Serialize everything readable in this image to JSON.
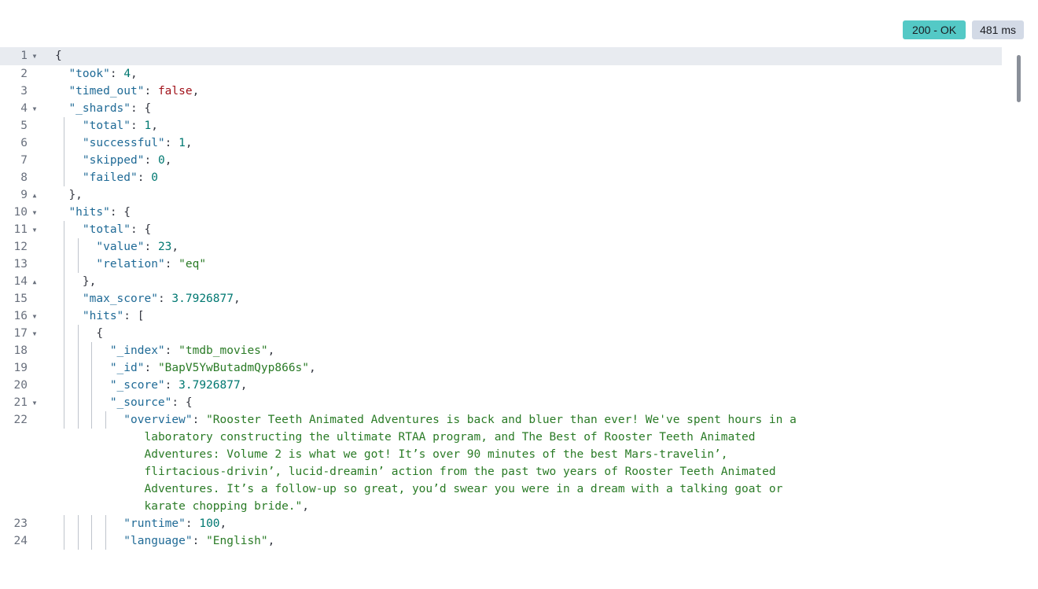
{
  "status": {
    "code_label": "200 - OK",
    "time_label": "481 ms"
  },
  "lines": [
    {
      "n": "1",
      "fold": "open",
      "indent": 0,
      "segs": [
        [
          "p",
          "{"
        ]
      ]
    },
    {
      "n": "2",
      "indent": 1,
      "segs": [
        [
          "k",
          "\"took\""
        ],
        [
          "p",
          ": "
        ],
        [
          "num-v",
          "4"
        ],
        [
          "p",
          ","
        ]
      ]
    },
    {
      "n": "3",
      "indent": 1,
      "segs": [
        [
          "k",
          "\"timed_out\""
        ],
        [
          "p",
          ": "
        ],
        [
          "bool",
          "false"
        ],
        [
          "p",
          ","
        ]
      ]
    },
    {
      "n": "4",
      "fold": "open",
      "indent": 1,
      "segs": [
        [
          "k",
          "\"_shards\""
        ],
        [
          "p",
          ": {"
        ]
      ]
    },
    {
      "n": "5",
      "indent": 2,
      "segs": [
        [
          "k",
          "\"total\""
        ],
        [
          "p",
          ": "
        ],
        [
          "num-v",
          "1"
        ],
        [
          "p",
          ","
        ]
      ]
    },
    {
      "n": "6",
      "indent": 2,
      "segs": [
        [
          "k",
          "\"successful\""
        ],
        [
          "p",
          ": "
        ],
        [
          "num-v",
          "1"
        ],
        [
          "p",
          ","
        ]
      ]
    },
    {
      "n": "7",
      "indent": 2,
      "segs": [
        [
          "k",
          "\"skipped\""
        ],
        [
          "p",
          ": "
        ],
        [
          "num-v",
          "0"
        ],
        [
          "p",
          ","
        ]
      ]
    },
    {
      "n": "8",
      "indent": 2,
      "segs": [
        [
          "k",
          "\"failed\""
        ],
        [
          "p",
          ": "
        ],
        [
          "num-v",
          "0"
        ]
      ]
    },
    {
      "n": "9",
      "fold": "close",
      "indent": 1,
      "segs": [
        [
          "p",
          "},"
        ]
      ]
    },
    {
      "n": "10",
      "fold": "open",
      "indent": 1,
      "segs": [
        [
          "k",
          "\"hits\""
        ],
        [
          "p",
          ": {"
        ]
      ]
    },
    {
      "n": "11",
      "fold": "open",
      "indent": 2,
      "segs": [
        [
          "k",
          "\"total\""
        ],
        [
          "p",
          ": {"
        ]
      ]
    },
    {
      "n": "12",
      "indent": 3,
      "segs": [
        [
          "k",
          "\"value\""
        ],
        [
          "p",
          ": "
        ],
        [
          "num-v",
          "23"
        ],
        [
          "p",
          ","
        ]
      ]
    },
    {
      "n": "13",
      "indent": 3,
      "segs": [
        [
          "k",
          "\"relation\""
        ],
        [
          "p",
          ": "
        ],
        [
          "str",
          "\"eq\""
        ]
      ]
    },
    {
      "n": "14",
      "fold": "close",
      "indent": 2,
      "segs": [
        [
          "p",
          "},"
        ]
      ]
    },
    {
      "n": "15",
      "indent": 2,
      "segs": [
        [
          "k",
          "\"max_score\""
        ],
        [
          "p",
          ": "
        ],
        [
          "num-v",
          "3.7926877"
        ],
        [
          "p",
          ","
        ]
      ]
    },
    {
      "n": "16",
      "fold": "open",
      "indent": 2,
      "segs": [
        [
          "k",
          "\"hits\""
        ],
        [
          "p",
          ": ["
        ]
      ]
    },
    {
      "n": "17",
      "fold": "open",
      "indent": 3,
      "segs": [
        [
          "p",
          "{"
        ]
      ]
    },
    {
      "n": "18",
      "indent": 4,
      "segs": [
        [
          "k",
          "\"_index\""
        ],
        [
          "p",
          ": "
        ],
        [
          "str",
          "\"tmdb_movies\""
        ],
        [
          "p",
          ","
        ]
      ]
    },
    {
      "n": "19",
      "indent": 4,
      "segs": [
        [
          "k",
          "\"_id\""
        ],
        [
          "p",
          ": "
        ],
        [
          "str",
          "\"BapV5YwButadmQyp866s\""
        ],
        [
          "p",
          ","
        ]
      ]
    },
    {
      "n": "20",
      "indent": 4,
      "segs": [
        [
          "k",
          "\"_score\""
        ],
        [
          "p",
          ": "
        ],
        [
          "num-v",
          "3.7926877"
        ],
        [
          "p",
          ","
        ]
      ]
    },
    {
      "n": "21",
      "fold": "open",
      "indent": 4,
      "segs": [
        [
          "k",
          "\"_source\""
        ],
        [
          "p",
          ": {"
        ]
      ]
    },
    {
      "n": "22",
      "indent": 5,
      "segs": [
        [
          "k",
          "\"overview\""
        ],
        [
          "p",
          ": "
        ],
        [
          "str",
          "\"Rooster Teeth Animated Adventures is back and bluer than ever! We've spent hours in a"
        ]
      ],
      "cont": [
        "laboratory constructing the ultimate RTAA program, and The Best of Rooster Teeth Animated",
        "Adventures: Volume 2 is what we got! It’s over 90 minutes of the best Mars-travelin’,",
        "flirtacious-drivin’, lucid-dreamin’ action from the past two years of Rooster Teeth Animated",
        "Adventures. It’s a follow-up so great, you’d swear you were in a dream with a talking goat or",
        "karate chopping bride.\""
      ],
      "tail": ","
    },
    {
      "n": "23",
      "indent": 5,
      "segs": [
        [
          "k",
          "\"runtime\""
        ],
        [
          "p",
          ": "
        ],
        [
          "num-v",
          "100"
        ],
        [
          "p",
          ","
        ]
      ]
    },
    {
      "n": "24",
      "indent": 5,
      "segs": [
        [
          "k",
          "\"language\""
        ],
        [
          "p",
          ": "
        ],
        [
          "str",
          "\"English\""
        ],
        [
          "p",
          ","
        ]
      ]
    }
  ]
}
